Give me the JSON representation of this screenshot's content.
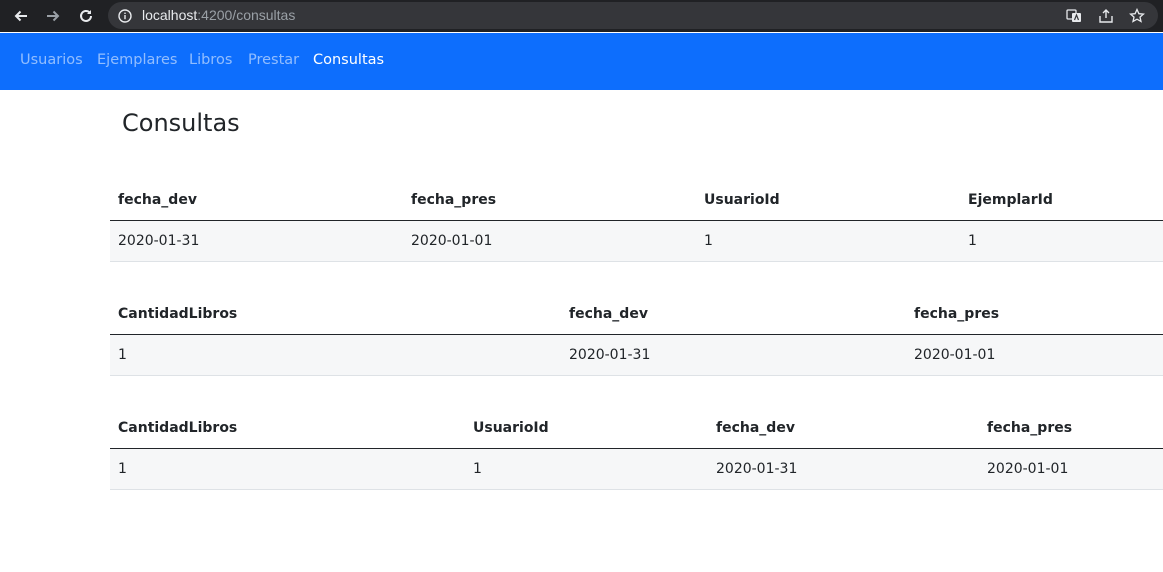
{
  "browser": {
    "url_host": "localhost",
    "url_path": ":4200/consultas"
  },
  "navbar": {
    "links": [
      "Usuarios",
      "Ejemplares",
      "Libros",
      "Prestar",
      "Consultas"
    ],
    "active": "Consultas"
  },
  "page": {
    "title": "Consultas"
  },
  "tables": [
    {
      "headers": [
        "fecha_dev",
        "fecha_pres",
        "UsuarioId",
        "EjemplarId"
      ],
      "rows": [
        [
          "2020-01-31",
          "2020-01-01",
          "1",
          "1"
        ]
      ]
    },
    {
      "headers": [
        "CantidadLibros",
        "fecha_dev",
        "fecha_pres"
      ],
      "rows": [
        [
          "1",
          "2020-01-31",
          "2020-01-01"
        ]
      ]
    },
    {
      "headers": [
        "CantidadLibros",
        "UsuarioId",
        "fecha_dev",
        "fecha_pres"
      ],
      "rows": [
        [
          "1",
          "1",
          "2020-01-31",
          "2020-01-01"
        ]
      ]
    }
  ],
  "colors": {
    "navbar": "#0d6efd",
    "browser_chrome": "#202124",
    "omnibox": "#35363a",
    "row_bg": "#f6f7f8"
  }
}
